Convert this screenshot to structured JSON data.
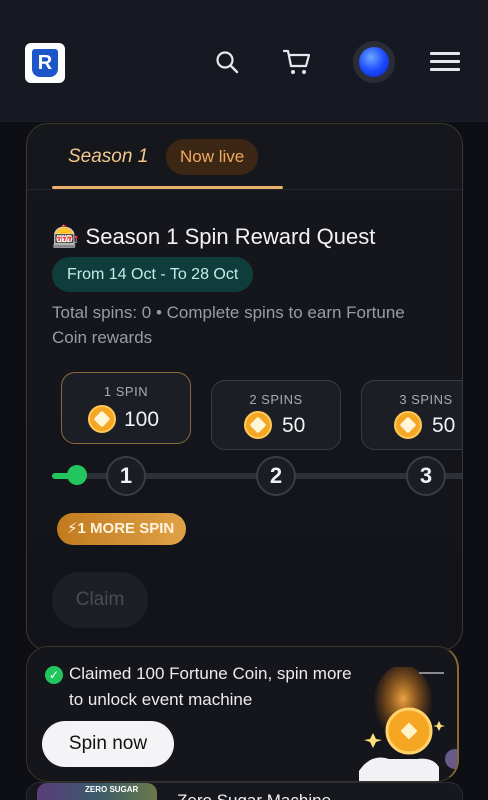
{
  "header": {
    "logo_letter": "R",
    "icons": [
      "search-icon",
      "cart-icon",
      "avatar",
      "menu-icon"
    ]
  },
  "tab": {
    "label": "Season 1",
    "badge": "Now live"
  },
  "quest": {
    "emoji": "🎰",
    "title": "Season 1 Spin Reward Quest",
    "date_range": "From 14 Oct - To 28 Oct",
    "description": "Total spins: 0 • Complete spins to earn Fortune Coin rewards"
  },
  "rewards": [
    {
      "label": "1 SPIN",
      "amount": "100"
    },
    {
      "label": "2 SPINS",
      "amount": "50"
    },
    {
      "label": "3 SPINS",
      "amount": "50"
    }
  ],
  "steps": [
    "1",
    "2",
    "3"
  ],
  "progress": {
    "completed_spins": 0
  },
  "more_badge": "⚡1 MORE SPIN",
  "claim_label": "Claim",
  "toast": {
    "message": "Claimed 100 Fortune Coin, spin more to unlock event machine",
    "button": "Spin now",
    "check": "✓"
  },
  "next_card": {
    "thumb_label": "ZERO SUGAR",
    "title": "Zero Sugar Machine"
  },
  "colors": {
    "accent_gold": "#e8b06a",
    "live_badge_bg": "#3b2714",
    "date_badge_bg": "#0f3d3b",
    "progress_green": "#22c55e",
    "coin": "#f5a623"
  }
}
